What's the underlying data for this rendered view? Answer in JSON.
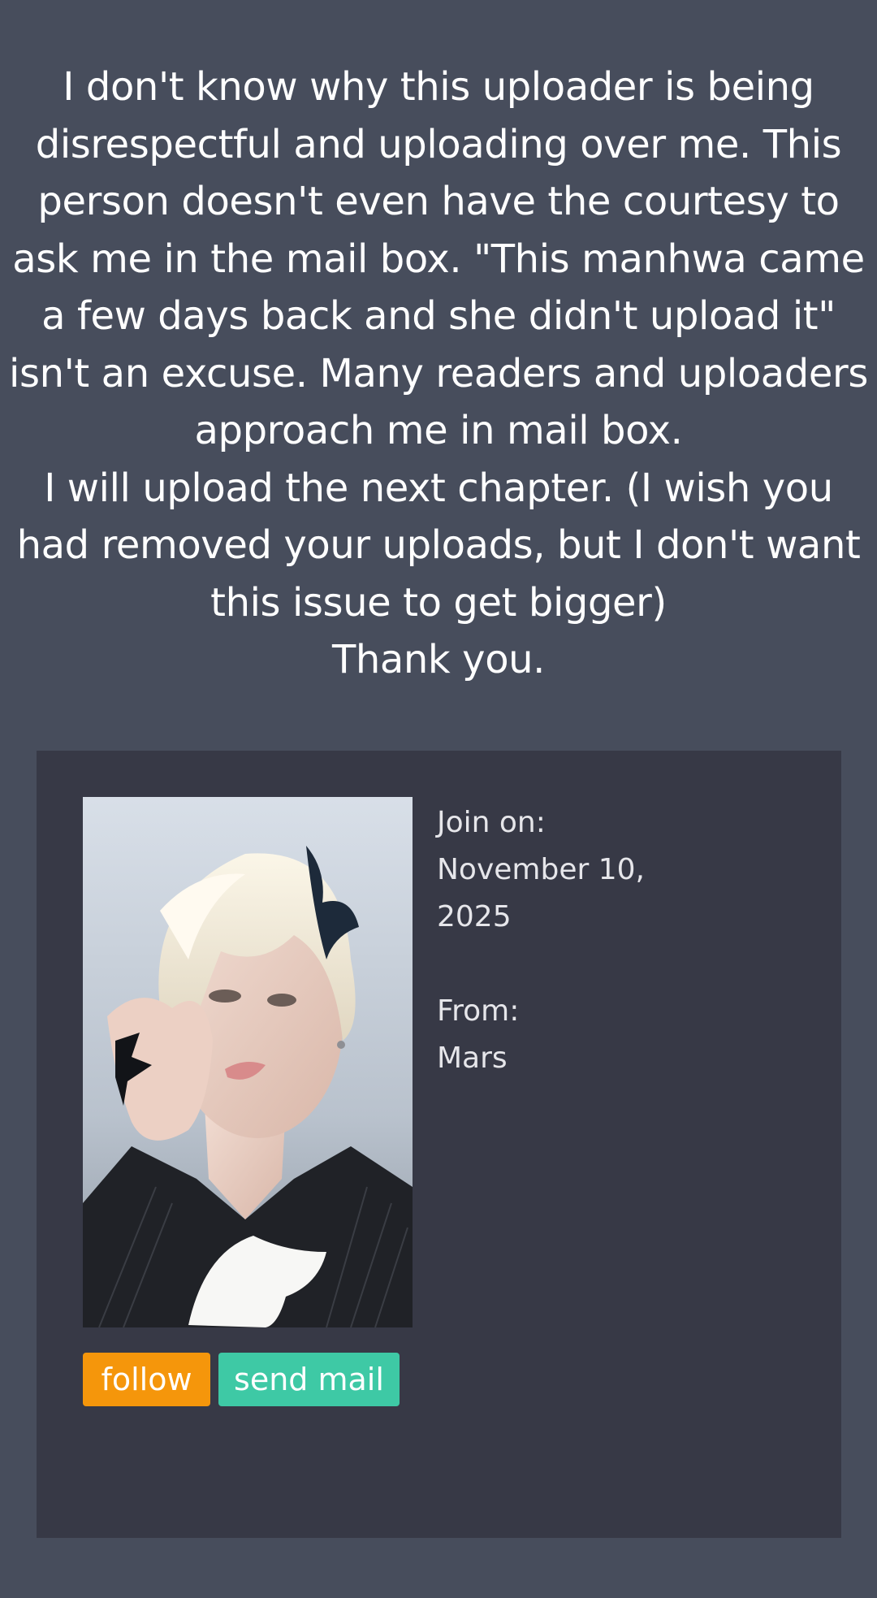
{
  "notice": {
    "lines": [
      "I don't know why this uploader is being",
      "disrespectful and uploading over me. This",
      "person doesn't even have the courtesy to",
      "ask me in the mail box. \"This manhwa came",
      "a few days back and she didn't upload it\"",
      "isn't an excuse. Many readers and uploaders",
      "approach me in mail box.",
      "I will upload the next chapter. (I wish you",
      "had removed your uploads, but I don't want",
      "this issue to get bigger)",
      "Thank you."
    ]
  },
  "profile": {
    "join_label": "Join on:",
    "join_date_line1": "November 10,",
    "join_date_line2": "2025",
    "from_label": "From:",
    "from_value": "Mars"
  },
  "actions": {
    "follow_label": "follow",
    "send_mail_label": "send mail"
  },
  "colors": {
    "page_bg": "#474d5c",
    "card_bg": "#373946",
    "follow_button": "#f5960b",
    "send_mail_button": "#3ec9a5"
  }
}
